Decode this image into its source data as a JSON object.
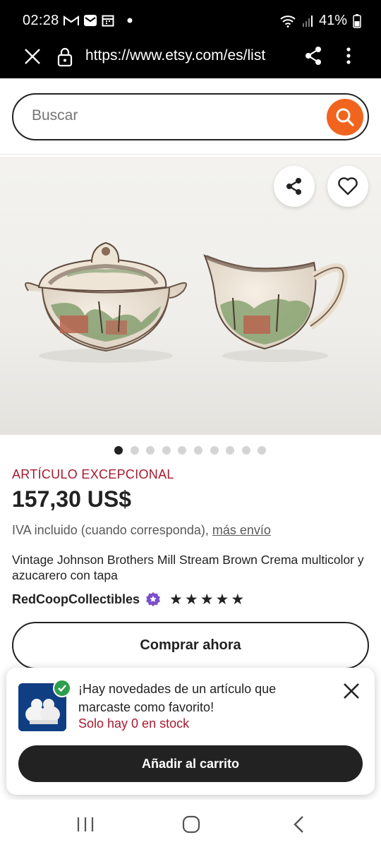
{
  "status_bar": {
    "time": "02:28",
    "battery": "41%"
  },
  "browser": {
    "url": "https://www.etsy.com/es/list"
  },
  "search": {
    "placeholder": "Buscar"
  },
  "gallery": {
    "image_count": 10,
    "active_index": 0
  },
  "product": {
    "badge": "ARTÍCULO EXCEPCIONAL",
    "price": "157,30 US$",
    "tax_text": "IVA incluido (cuando corresponda),",
    "tax_link": "más envío",
    "title": "Vintage Johnson Brothers Mill Stream Brown Crema multicolor y azucarero con tapa",
    "seller": "RedCoopCollectibles",
    "rating": 5,
    "buy_label": "Comprar ahora"
  },
  "notification": {
    "message": "¡Hay novedades de un artículo que marcaste como favorito!",
    "stock": "Solo hay 0 en stock",
    "cart_label": "Añadir al carrito"
  },
  "colors": {
    "accent_orange": "#f1641e",
    "badge_red": "#a61a2e",
    "check_green": "#2e9e4f",
    "dark": "#222222"
  }
}
